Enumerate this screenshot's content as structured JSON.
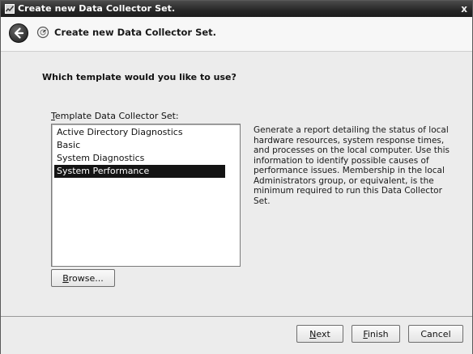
{
  "window": {
    "title": "Create new Data Collector Set.",
    "close_glyph": "x"
  },
  "nav": {
    "title": "Create new Data Collector Set."
  },
  "main": {
    "question": "Which template would you like to use?",
    "list_label_mnemonic": "T",
    "list_label_rest": "emplate Data Collector Set:",
    "templates": [
      "Active Directory Diagnostics",
      "Basic",
      "System Diagnostics",
      "System Performance"
    ],
    "selected_template": "System Performance",
    "description": "Generate a report detailing the status of local hardware resources, system response times, and processes on the local computer. Use this information to identify possible causes of performance issues. Membership in the local Administrators group, or equivalent, is the minimum required to run this Data Collector Set.",
    "browse_mnemonic": "B",
    "browse_rest": "rowse..."
  },
  "footer": {
    "next_mnemonic": "N",
    "next_rest": "ext",
    "finish_mnemonic": "F",
    "finish_rest": "inish",
    "cancel_label": "Cancel"
  },
  "icons": {
    "app": "performance-monitor-icon",
    "back": "back-arrow-icon",
    "wizard": "data-collector-icon"
  },
  "colors": {
    "titlebar": "#262626",
    "selection": "#141414",
    "window_bg": "#ececec"
  }
}
